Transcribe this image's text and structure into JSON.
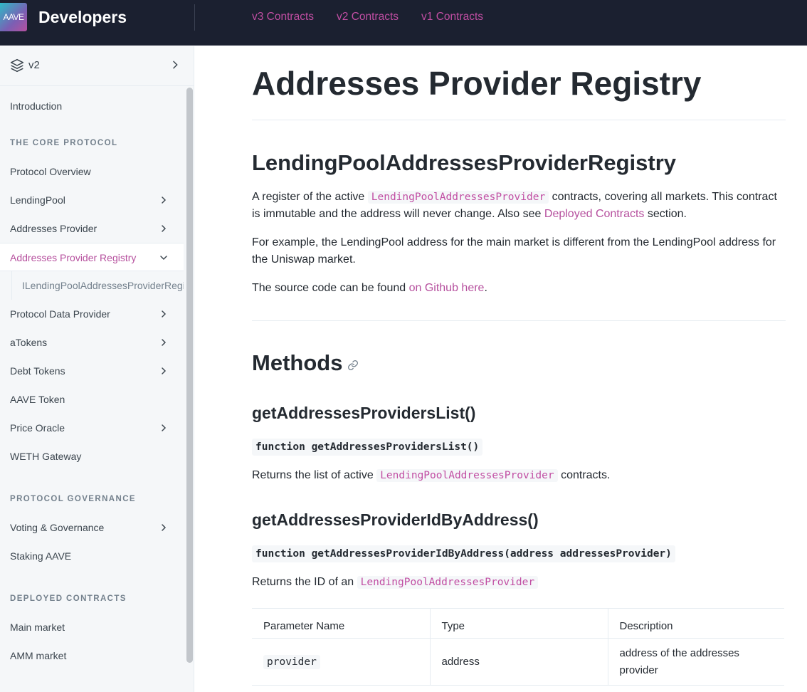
{
  "header": {
    "logo_text": "AAVE",
    "brand": "Developers",
    "nav": [
      "v3 Contracts",
      "v2 Contracts",
      "v1 Contracts"
    ]
  },
  "sidebar": {
    "version": "v2",
    "items_top": {
      "introduction": "Introduction"
    },
    "section_core": "THE CORE PROTOCOL",
    "core_items": {
      "protocol_overview": "Protocol Overview",
      "lending_pool": "LendingPool",
      "addresses_provider": "Addresses Provider",
      "addresses_provider_registry": "Addresses Provider Registry",
      "sub_interface": "ILendingPoolAddressesProviderRegistry",
      "protocol_data_provider": "Protocol Data Provider",
      "atokens": "aTokens",
      "debt_tokens": "Debt Tokens",
      "aave_token": "AAVE Token",
      "price_oracle": "Price Oracle",
      "weth_gateway": "WETH Gateway"
    },
    "section_governance": "PROTOCOL GOVERNANCE",
    "governance_items": {
      "voting": "Voting & Governance",
      "staking": "Staking AAVE"
    },
    "section_deployed": "DEPLOYED CONTRACTS",
    "deployed_items": {
      "main_market": "Main market",
      "amm_market": "AMM market"
    }
  },
  "main": {
    "title": "Addresses Provider Registry",
    "contract_title": "LendingPoolAddressesProviderRegistry",
    "p1": {
      "before": "A register of the active ",
      "code": "LendingPoolAddressesProvider",
      "middle": " contracts, covering all markets. This contract is immutable and the address will never change. Also see ",
      "link": "Deployed Contracts",
      "after": " section."
    },
    "p2": "For example, the LendingPool address for the main market is different from the LendingPool address for the Uniswap market.",
    "p3": {
      "before": "The source code can be found ",
      "link": "on Github here",
      "after": "."
    },
    "methods_title": "Methods",
    "method1": {
      "name": "getAddressesProvidersList()",
      "signature": "function getAddressesProvidersList()",
      "desc_before": "Returns the list of active ",
      "desc_code": "LendingPoolAddressesProvider",
      "desc_after": " contracts."
    },
    "method2": {
      "name": "getAddressesProviderIdByAddress()",
      "signature": "function getAddressesProviderIdByAddress(address addressesProvider)",
      "desc_before": "Returns the ID of an ",
      "desc_code": "LendingPoolAddressesProvider"
    },
    "table": {
      "headers": [
        "Parameter Name",
        "Type",
        "Description"
      ],
      "rows": [
        {
          "name": "provider",
          "type": "address",
          "description": "address of the addresses provider"
        }
      ]
    }
  }
}
